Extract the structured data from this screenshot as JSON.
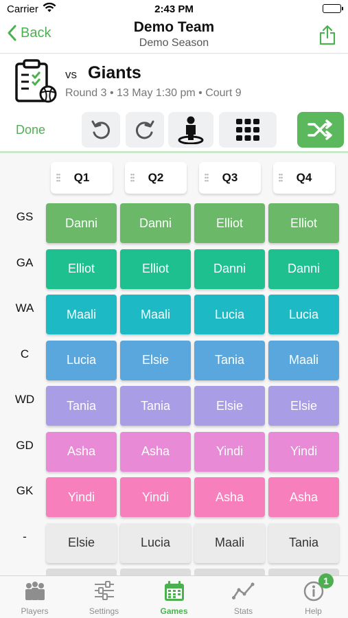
{
  "status_bar": {
    "carrier": "Carrier",
    "time": "2:43 PM"
  },
  "nav": {
    "back_label": "Back",
    "title": "Demo Team",
    "subtitle": "Demo Season"
  },
  "game": {
    "vs_label": "vs",
    "opponent": "Giants",
    "meta": "Round 3 • 13 May 1:30 pm • Court 9"
  },
  "toolbar": {
    "done_label": "Done"
  },
  "quarters": [
    "Q1",
    "Q2",
    "Q3",
    "Q4"
  ],
  "positions": [
    "GS",
    "GA",
    "WA",
    "C",
    "WD",
    "GD",
    "GK",
    "-"
  ],
  "position_colors": {
    "GS": "#6cb869",
    "GA": "#1fc08f",
    "WA": "#1dbac6",
    "C": "#5aa7dd",
    "WD": "#a99de6",
    "GD": "#e88ad5",
    "GK": "#f77fbc",
    "-": "#ebebeb"
  },
  "lineup": [
    [
      "Danni",
      "Danni",
      "Elliot",
      "Elliot"
    ],
    [
      "Elliot",
      "Elliot",
      "Danni",
      "Danni"
    ],
    [
      "Maali",
      "Maali",
      "Lucia",
      "Lucia"
    ],
    [
      "Lucia",
      "Elsie",
      "Tania",
      "Maali"
    ],
    [
      "Tania",
      "Tania",
      "Elsie",
      "Elsie"
    ],
    [
      "Asha",
      "Asha",
      "Yindi",
      "Yindi"
    ],
    [
      "Yindi",
      "Yindi",
      "Asha",
      "Asha"
    ],
    [
      "Elsie",
      "Lucia",
      "Maali",
      "Tania"
    ]
  ],
  "tabs": [
    {
      "label": "Players",
      "icon": "players-icon"
    },
    {
      "label": "Settings",
      "icon": "sliders-icon"
    },
    {
      "label": "Games",
      "icon": "calendar-icon",
      "active": true
    },
    {
      "label": "Stats",
      "icon": "stats-line-icon"
    },
    {
      "label": "Help",
      "icon": "info-icon",
      "badge": "1"
    }
  ],
  "accent_color": "#4cb050"
}
